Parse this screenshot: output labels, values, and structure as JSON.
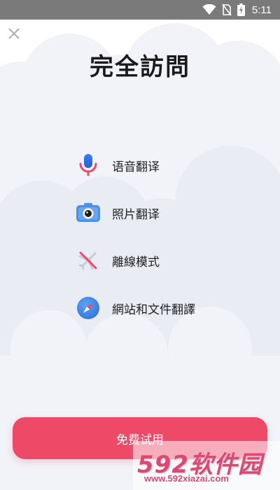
{
  "status_bar": {
    "time": "5:11",
    "icons": [
      "wifi-icon",
      "no-sim-icon",
      "battery-charging-icon"
    ]
  },
  "close": {
    "icon": "close-icon"
  },
  "title": "完全訪問",
  "features": [
    {
      "label": "语音翻译",
      "icon": "microphone-icon"
    },
    {
      "label": "照片翻译",
      "icon": "camera-icon"
    },
    {
      "label": "離線模式",
      "icon": "airplane-off-icon"
    },
    {
      "label": "網站和文件翻譯",
      "icon": "compass-icon"
    }
  ],
  "trial_button": {
    "label": "免费试用"
  },
  "watermark": {
    "logo": "592软件园",
    "url": "www.592xiazai.com"
  },
  "colors": {
    "accent": "#ee4a68",
    "status_bar": "#7a7a7a",
    "cloud": "#f1f3f8"
  }
}
